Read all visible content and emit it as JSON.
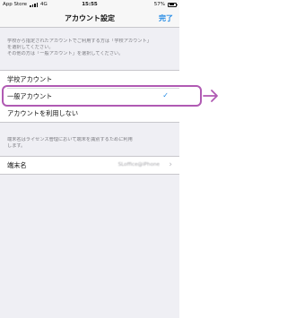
{
  "status_bar": {
    "carrier": "App Store",
    "network": "4G",
    "time": "15:55",
    "battery": "57%"
  },
  "nav": {
    "title": "アカウント設定",
    "done_label": "完了"
  },
  "intro_note": [
    "学校から指定されたアカウントでご利用する方は「学校アカウント」",
    "を選択してください。",
    "その他の方は「一般アカウント」を選択してください。"
  ],
  "accounts": {
    "school": "学校アカウント",
    "general": "一般アカウント",
    "none": "アカウントを利用しない"
  },
  "device_note": [
    "端末名はライセンス管理において端末を識別するために利用",
    "します。"
  ],
  "device": {
    "label": "端末名",
    "value": "SLoffice@iPhone"
  },
  "colors": {
    "accent": "#1e88e5",
    "highlight": "#b05ab3"
  }
}
